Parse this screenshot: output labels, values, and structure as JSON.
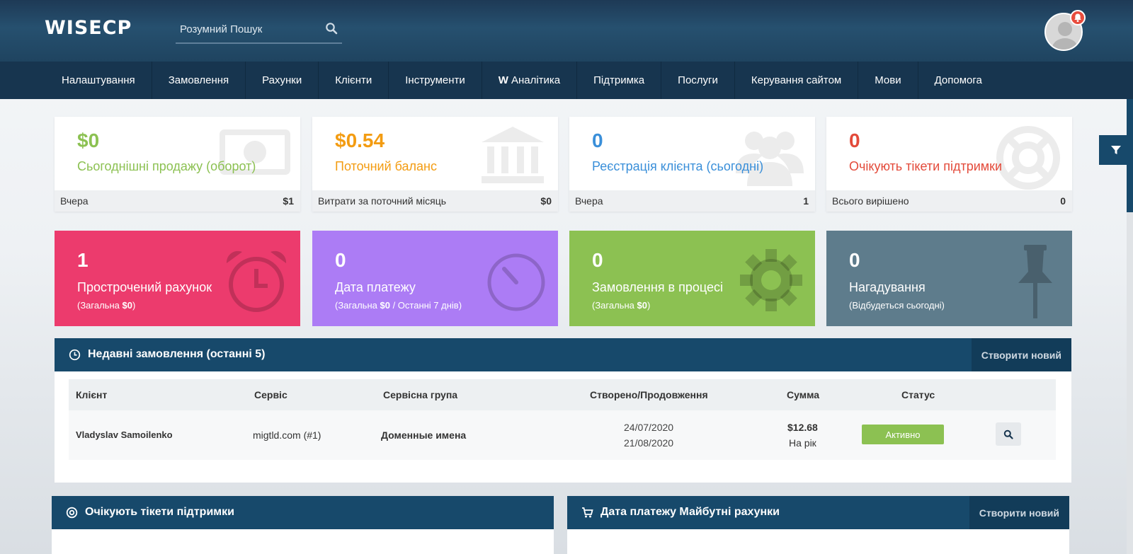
{
  "header": {
    "logo": "WISECP",
    "search_placeholder": "Розумний Пошук"
  },
  "nav": {
    "items": [
      {
        "label": "Налаштування"
      },
      {
        "label": "Замовлення"
      },
      {
        "label": "Рахунки"
      },
      {
        "label": "Клієнти"
      },
      {
        "label": "Інструменти"
      },
      {
        "label": "Аналітика",
        "prefix": "W"
      },
      {
        "label": "Підтримка"
      },
      {
        "label": "Послуги"
      },
      {
        "label": "Керування сайтом"
      },
      {
        "label": "Мови"
      },
      {
        "label": "Допомога"
      }
    ]
  },
  "stats": [
    {
      "value": "$0",
      "label": "Сьогоднішні продажу (оборот)",
      "foot_label": "Вчера",
      "foot_value": "$1",
      "color": "#8cc152",
      "icon": "money-icon"
    },
    {
      "value": "$0.54",
      "label": "Поточний баланс",
      "foot_label": "Витрати за поточний місяць",
      "foot_value": "$0",
      "color": "#f39c12",
      "icon": "bank-icon"
    },
    {
      "value": "0",
      "label": "Реєстрація клієнта (сьогодні)",
      "foot_label": "Вчера",
      "foot_value": "1",
      "color": "#3a8fd9",
      "icon": "users-icon"
    },
    {
      "value": "0",
      "label": "Очікують тікети підтримки",
      "foot_label": "Всього вирішено",
      "foot_value": "0",
      "color": "#e34a3a",
      "icon": "lifebuoy-icon"
    }
  ],
  "color_cards": [
    {
      "value": "1",
      "label": "Прострочений рахунок",
      "sub_prefix": "(Загальна ",
      "sub_bold": "$0",
      "sub_suffix": ")",
      "bg": "#ec3b6d",
      "icon": "alarm-clock-icon"
    },
    {
      "value": "0",
      "label": "Дата платежу",
      "sub_prefix": "(Загальна ",
      "sub_bold": "$0",
      "sub_suffix": " / Останні 7 днів)",
      "bg": "#ac7cf5",
      "icon": "stopwatch-icon"
    },
    {
      "value": "0",
      "label": "Замовлення в процесі",
      "sub_prefix": "(Загальна ",
      "sub_bold": "$0",
      "sub_suffix": ")",
      "bg": "#8cc152",
      "icon": "gear-icon"
    },
    {
      "value": "0",
      "label": "Нагадування",
      "sub_prefix": "(Відбудеться сьогодні)",
      "sub_bold": "",
      "sub_suffix": "",
      "bg": "#5e7c8c",
      "icon": "pin-icon"
    }
  ],
  "recent_orders": {
    "title": "Недавні замовлення (останні 5)",
    "create_label": "Створити новий",
    "columns": [
      "Клієнт",
      "Сервіс",
      "Сервісна група",
      "Створено/Продовження",
      "Сумма",
      "Статус"
    ],
    "rows": [
      {
        "client": "Vladyslav Samoilenko",
        "service": "migtld.com (#1)",
        "group": "Доменные имена",
        "created": "24/07/2020",
        "renewal": "21/08/2020",
        "amount": "$12.68",
        "period": "На рік",
        "status": "Активно"
      }
    ]
  },
  "bottom_panels": {
    "tickets_title": "Очікують тікети підтримки",
    "invoices_title": "Дата платежу Майбутні рахунки",
    "invoices_create_label": "Створити новий"
  }
}
